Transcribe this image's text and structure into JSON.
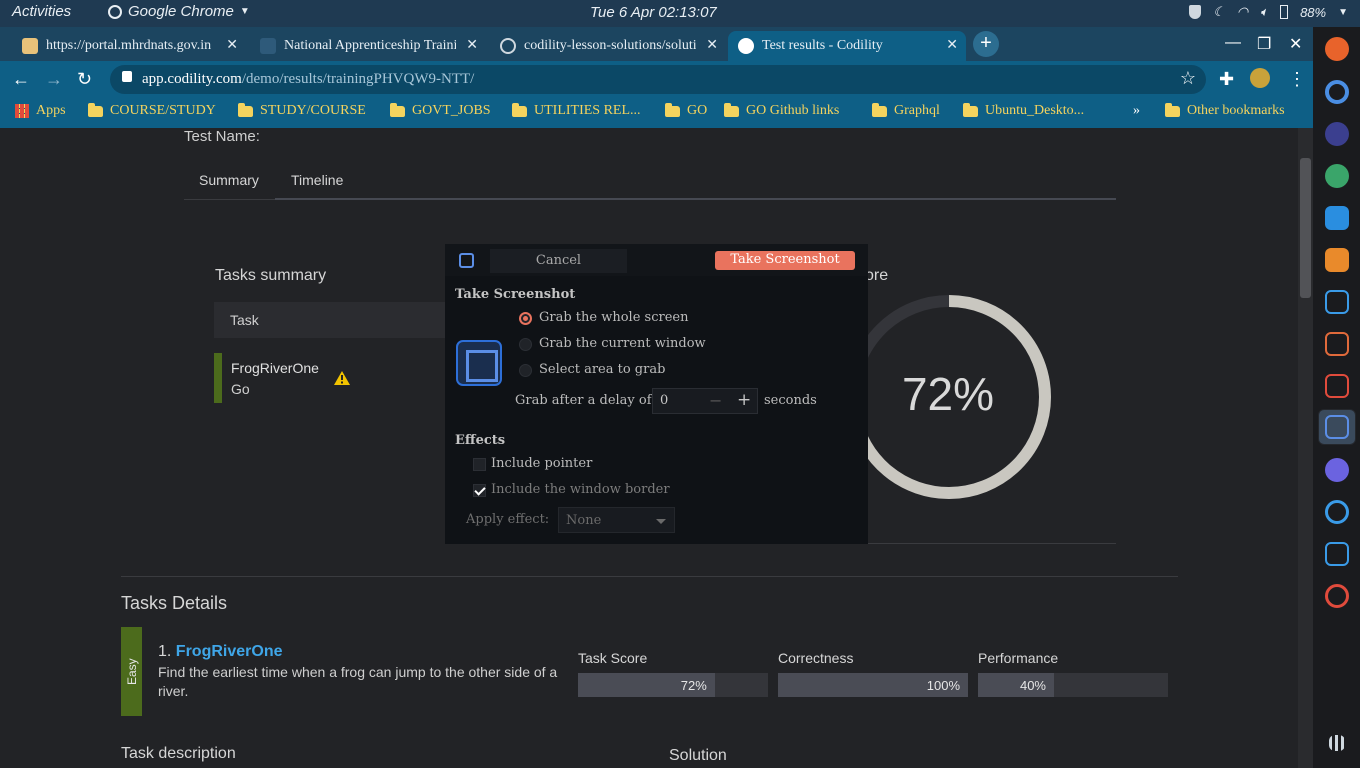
{
  "topbar": {
    "activities": "Activities",
    "app": "Google Chrome",
    "clock": "Tue 6 Apr  02:13:07",
    "battery": "88%"
  },
  "tabs": [
    {
      "title": "https://portal.mhrdnats.gov.in"
    },
    {
      "title": "National Apprenticeship Training Scheme"
    },
    {
      "title": "codility-lesson-solutions/solutions"
    },
    {
      "title": "Test results - Codility"
    }
  ],
  "omnibox": {
    "host": "app.codility.com",
    "path": "/demo/results/trainingPHVQW9-NTT/"
  },
  "bookmarks": [
    "Apps",
    "COURSE/STUDY",
    "STUDY/COURSE",
    "GOVT_JOBS",
    "UTILITIES REL...",
    "GO",
    "GO Github links",
    "Graphql",
    "Ubuntu_Deskto...",
    "»",
    "Other bookmarks"
  ],
  "page": {
    "test_name_label": "Test Name:",
    "tabs": [
      "Summary",
      "Timeline"
    ],
    "tasks_summary": "Tasks summary",
    "task_col": "Task",
    "task": {
      "name": "FrogRiverOne",
      "lang": "Go"
    },
    "score_label": "ore",
    "score_pct": "72%",
    "score_value": 0.72,
    "tasks_details": "Tasks Details",
    "difficulty": "Easy",
    "task_num": "1. ",
    "task_link": "FrogRiverOne",
    "task_desc": "Find the earliest time when a frog can jump to the other side of a river.",
    "metrics": [
      {
        "label": "Task Score",
        "value": "72%",
        "fraction": 0.72
      },
      {
        "label": "Correctness",
        "value": "100%",
        "fraction": 1.0
      },
      {
        "label": "Performance",
        "value": "40%",
        "fraction": 0.4
      }
    ],
    "task_description": "Task description",
    "solution": "Solution"
  },
  "dialog": {
    "cancel": "Cancel",
    "take": "Take Screenshot",
    "section1": "Take Screenshot",
    "options": [
      "Grab the whole screen",
      "Grab the current window",
      "Select area to grab"
    ],
    "delay_label": "Grab after a delay of",
    "delay_value": "0",
    "seconds": "seconds",
    "effects": "Effects",
    "include_pointer": "Include pointer",
    "include_border": "Include the window border",
    "apply_effect": "Apply effect:",
    "effect_value": "None"
  }
}
